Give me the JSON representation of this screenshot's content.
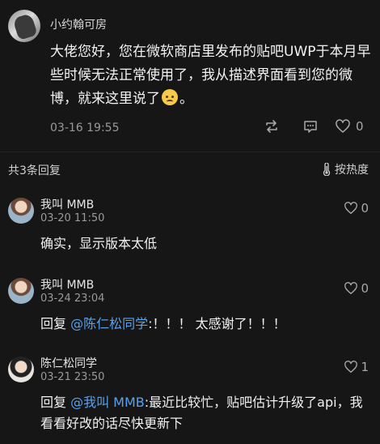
{
  "main_post": {
    "author": "小约翰可房",
    "text_before_emoji": "大佬您好，您在微软商店里发布的贴吧UWP于本月早些时候无法正常使用了，我从描述界面看到您的微博，就来这里说了",
    "emoji": "sweat-smile-emoji",
    "text_after_emoji": "。",
    "time": "03-16 19:55",
    "like_count": "0"
  },
  "replies_header": {
    "count_label": "共3条回复",
    "sort_label": "按热度"
  },
  "replies": [
    {
      "author": "我叫 MMB",
      "time": "03-20 11:50",
      "likes": "0",
      "text": "确实，显示版本太低"
    },
    {
      "author": "我叫 MMB",
      "time": "03-24 23:04",
      "likes": "0",
      "reply_prefix": "回复 ",
      "mention": "@陈仁松同学",
      "text": ":！！！ 太感谢了！！！"
    },
    {
      "author": "陈仁松同学",
      "time": "03-21 23:50",
      "likes": "1",
      "reply_prefix": "回复 ",
      "mention": "@我叫 MMB",
      "text": ":最近比较忙，贴吧估计升级了api，我看看好改的话尽快更新下"
    }
  ],
  "colors": {
    "background": "#161616",
    "mention": "#5aa0ea",
    "secondary_text": "#9a9a9a"
  }
}
